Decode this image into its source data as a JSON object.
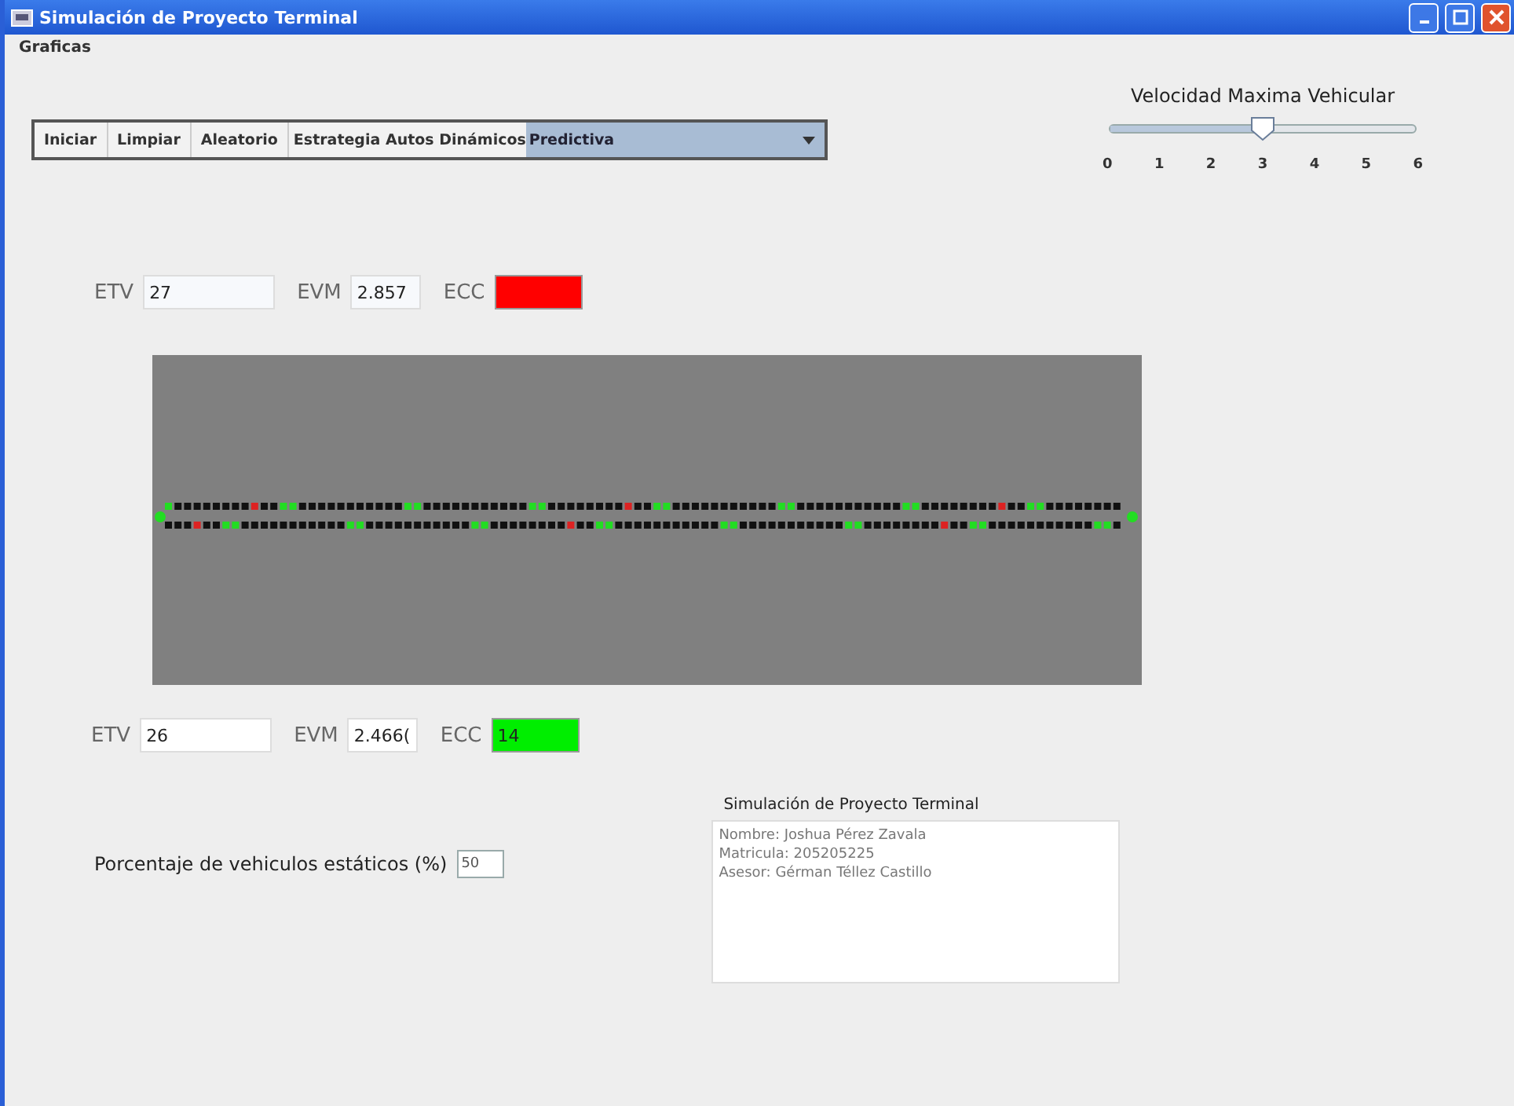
{
  "window": {
    "title": "Simulación de Proyecto Terminal"
  },
  "menu": [
    {
      "label": "Graficas"
    }
  ],
  "toolbar": {
    "buttons": [
      "Iniciar",
      "Limpiar",
      "Aleatorio"
    ],
    "strategy_label": "Estrategia Autos Dinámicos",
    "strategy_value": "Predictiva"
  },
  "speed": {
    "title": "Velocidad Maxima Vehicular",
    "level": 0.5,
    "ticks": [
      "0",
      "1",
      "2",
      "3",
      "4",
      "5",
      "6"
    ]
  },
  "top_stats": {
    "etv": {
      "label": "ETV",
      "value": "27"
    },
    "evm": {
      "label": "EVM",
      "value": "2.857"
    },
    "ecc": {
      "label": "ECC",
      "color": "#ff0000"
    }
  },
  "bottom_stats": {
    "etv": {
      "label": "ETV",
      "value": "26"
    },
    "evm": {
      "label": "EVM",
      "value": "2.466("
    },
    "ecc": {
      "label": "ECC",
      "value": "14",
      "color": "#00ee00"
    }
  },
  "static_vehicles": {
    "label": "Porcentaje de vehiculos estáticos (%)",
    "value": "50"
  },
  "info": {
    "title": "Simulación de Proyecto Terminal",
    "lines": [
      "Nombre: Joshua Pérez Zavala",
      "Matricula: 205205225",
      "Asesor: Gérman Téllez Castillo"
    ]
  }
}
